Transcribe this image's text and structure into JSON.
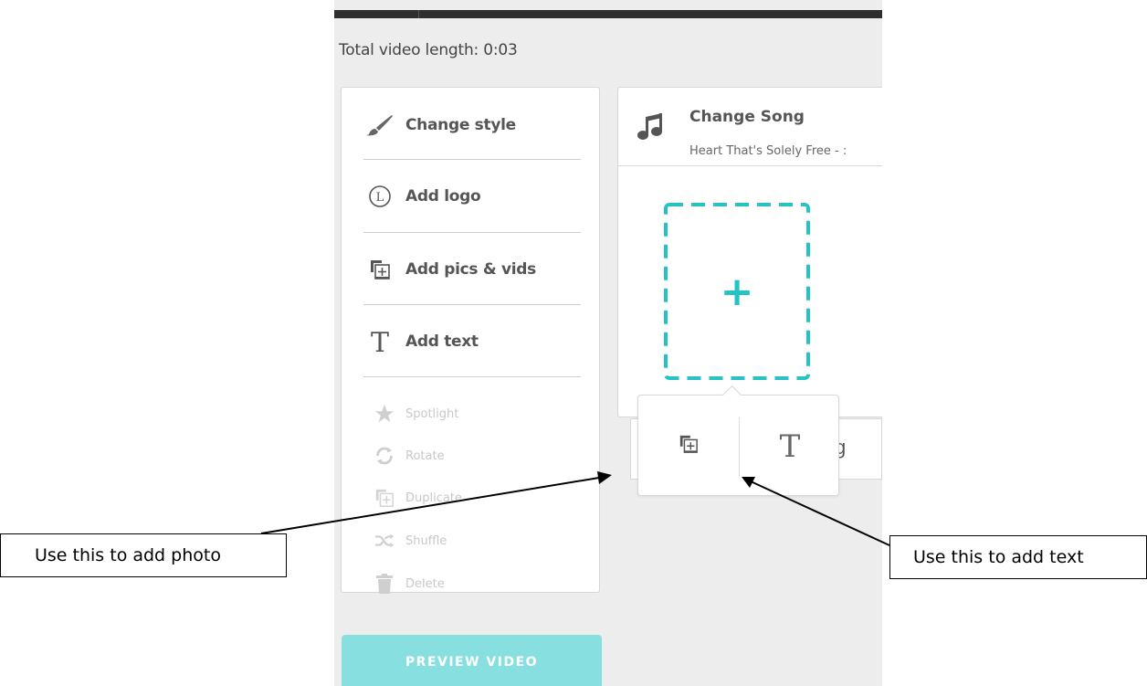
{
  "header": {
    "total_length_label": "Total video length: 0:03"
  },
  "tools": [
    {
      "label": "Change style",
      "icon": "brush-icon"
    },
    {
      "label": "Add logo",
      "icon": "logo-icon"
    },
    {
      "label": "Add pics & vids",
      "icon": "add-media-icon"
    },
    {
      "label": "Add text",
      "icon": "text-icon"
    }
  ],
  "minor_tools": [
    {
      "label": "Spotlight",
      "icon": "star-icon"
    },
    {
      "label": "Rotate",
      "icon": "rotate-icon"
    },
    {
      "label": "Duplicate",
      "icon": "duplicate-icon"
    },
    {
      "label": "Shuffle",
      "icon": "shuffle-icon"
    },
    {
      "label": "Delete",
      "icon": "trash-icon"
    }
  ],
  "preview_button": "PREVIEW VIDEO",
  "song": {
    "title": "Change Song",
    "subtitle": "Heart That's Solely Free - :"
  },
  "drop_zone": {
    "symbol": "+"
  },
  "popover": {
    "text_symbol": "T"
  },
  "below_bar": {
    "partial_text": "g"
  },
  "annotations": {
    "photo": "Use this to add photo",
    "text": "Use this to add text"
  },
  "colors": {
    "accent": "#26c2c8",
    "preview_button": "#88dfe0",
    "topbar": "#2f2f2f"
  }
}
